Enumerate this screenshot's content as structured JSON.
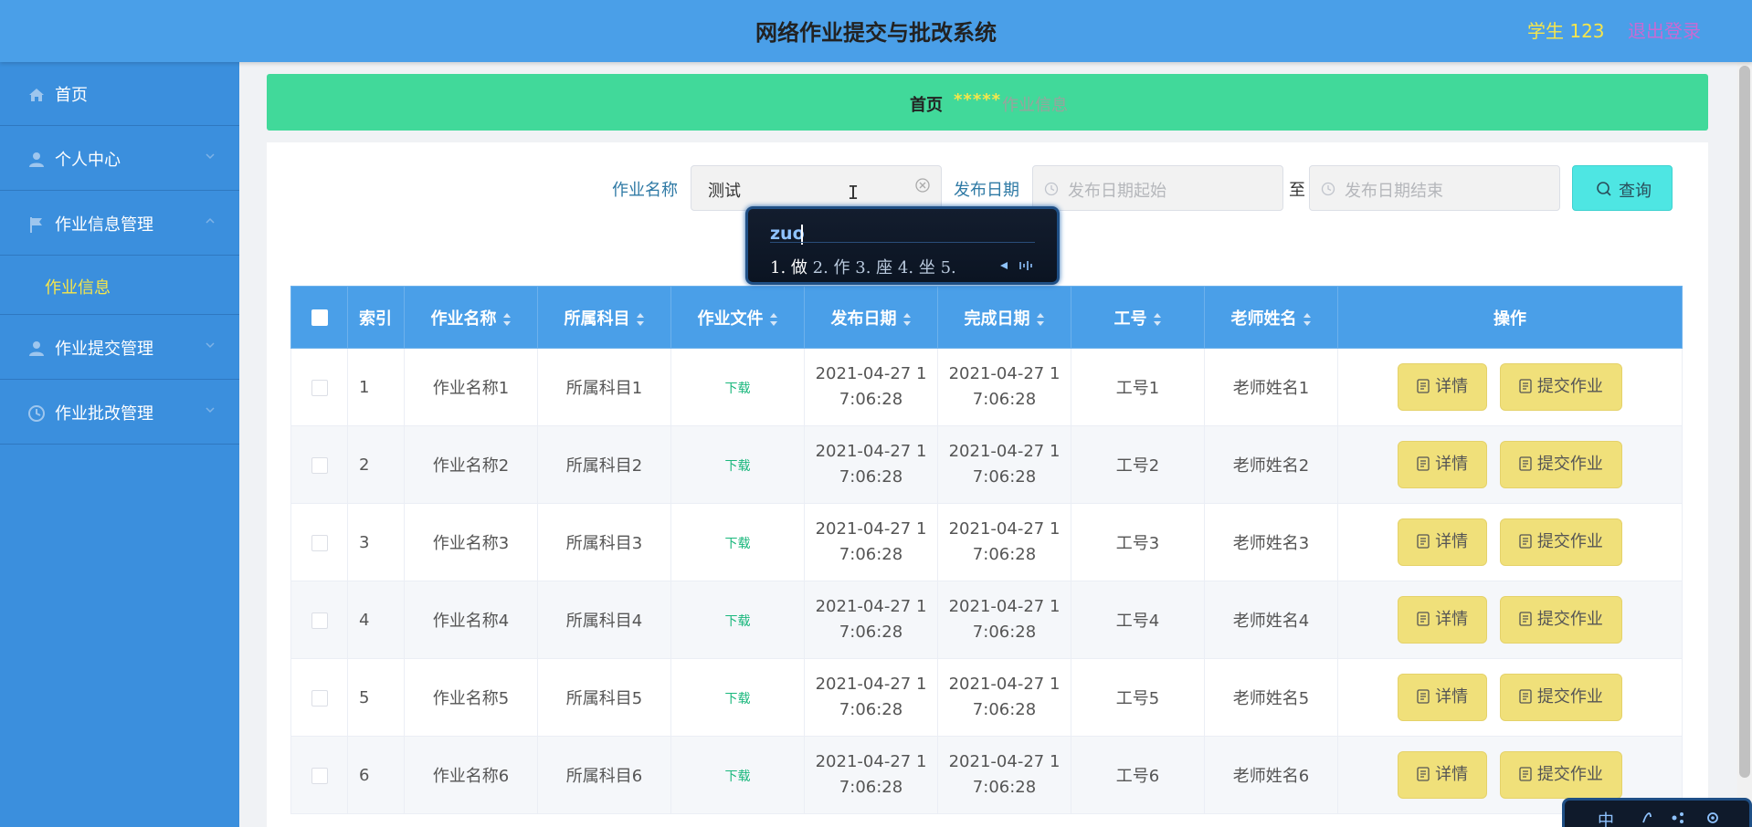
{
  "header": {
    "title": "网络作业提交与批改系统",
    "user": "学生 123",
    "logout": "退出登录"
  },
  "sidebar": {
    "items": [
      {
        "label": "首页",
        "icon": "home-icon"
      },
      {
        "label": "个人中心",
        "icon": "user-icon"
      },
      {
        "label": "作业信息管理",
        "icon": "flag-icon"
      },
      {
        "label": "作业提交管理",
        "icon": "user-icon"
      },
      {
        "label": "作业批改管理",
        "icon": "clock-icon"
      }
    ],
    "sub_item": "作业信息"
  },
  "breadcrumb": {
    "home": "首页",
    "separator": "*****",
    "current": "作业信息"
  },
  "search": {
    "name_label": "作业名称",
    "name_value": "测试",
    "date_label": "发布日期",
    "start_placeholder": "发布日期起始",
    "to": "至",
    "end_placeholder": "发布日期结束",
    "query": "查询"
  },
  "ime": {
    "pinyin": "zuo",
    "candidates": [
      "1. 做",
      "2. 作",
      "3. 座",
      "4. 坐",
      "5."
    ],
    "status_char": "中"
  },
  "table": {
    "headers": {
      "index": "索引",
      "name": "作业名称",
      "subject": "所属科目",
      "file": "作业文件",
      "publish": "发布日期",
      "finish": "完成日期",
      "job_no": "工号",
      "teacher": "老师姓名",
      "ops": "操作"
    },
    "rows": [
      {
        "index": "1",
        "name": "作业名称1",
        "subject": "所属科目1",
        "file": "下载",
        "publish_l1": "2021-04-27 1",
        "publish_l2": "7:06:28",
        "finish_l1": "2021-04-27 1",
        "finish_l2": "7:06:28",
        "job_no": "工号1",
        "teacher": "老师姓名1",
        "detail": "详情",
        "submit": "提交作业"
      },
      {
        "index": "2",
        "name": "作业名称2",
        "subject": "所属科目2",
        "file": "下载",
        "publish_l1": "2021-04-27 1",
        "publish_l2": "7:06:28",
        "finish_l1": "2021-04-27 1",
        "finish_l2": "7:06:28",
        "job_no": "工号2",
        "teacher": "老师姓名2",
        "detail": "详情",
        "submit": "提交作业"
      },
      {
        "index": "3",
        "name": "作业名称3",
        "subject": "所属科目3",
        "file": "下载",
        "publish_l1": "2021-04-27 1",
        "publish_l2": "7:06:28",
        "finish_l1": "2021-04-27 1",
        "finish_l2": "7:06:28",
        "job_no": "工号3",
        "teacher": "老师姓名3",
        "detail": "详情",
        "submit": "提交作业"
      },
      {
        "index": "4",
        "name": "作业名称4",
        "subject": "所属科目4",
        "file": "下载",
        "publish_l1": "2021-04-27 1",
        "publish_l2": "7:06:28",
        "finish_l1": "2021-04-27 1",
        "finish_l2": "7:06:28",
        "job_no": "工号4",
        "teacher": "老师姓名4",
        "detail": "详情",
        "submit": "提交作业"
      },
      {
        "index": "5",
        "name": "作业名称5",
        "subject": "所属科目5",
        "file": "下载",
        "publish_l1": "2021-04-27 1",
        "publish_l2": "7:06:28",
        "finish_l1": "2021-04-27 1",
        "finish_l2": "7:06:28",
        "job_no": "工号5",
        "teacher": "老师姓名5",
        "detail": "详情",
        "submit": "提交作业"
      },
      {
        "index": "6",
        "name": "作业名称6",
        "subject": "所属科目6",
        "file": "下载",
        "publish_l1": "2021-04-27 1",
        "publish_l2": "7:06:28",
        "finish_l1": "2021-04-27 1",
        "finish_l2": "7:06:28",
        "job_no": "工号6",
        "teacher": "老师姓名6",
        "detail": "详情",
        "submit": "提交作业"
      }
    ]
  },
  "colors": {
    "header": "#4a9fe8",
    "sidebar": "#3b8fdd",
    "breadcrumb": "#41d99a",
    "accent_yellow": "#f7e64a",
    "button_yellow": "#f0e07a",
    "query_cyan": "#4ee6e3",
    "download_green": "#19b77c"
  }
}
